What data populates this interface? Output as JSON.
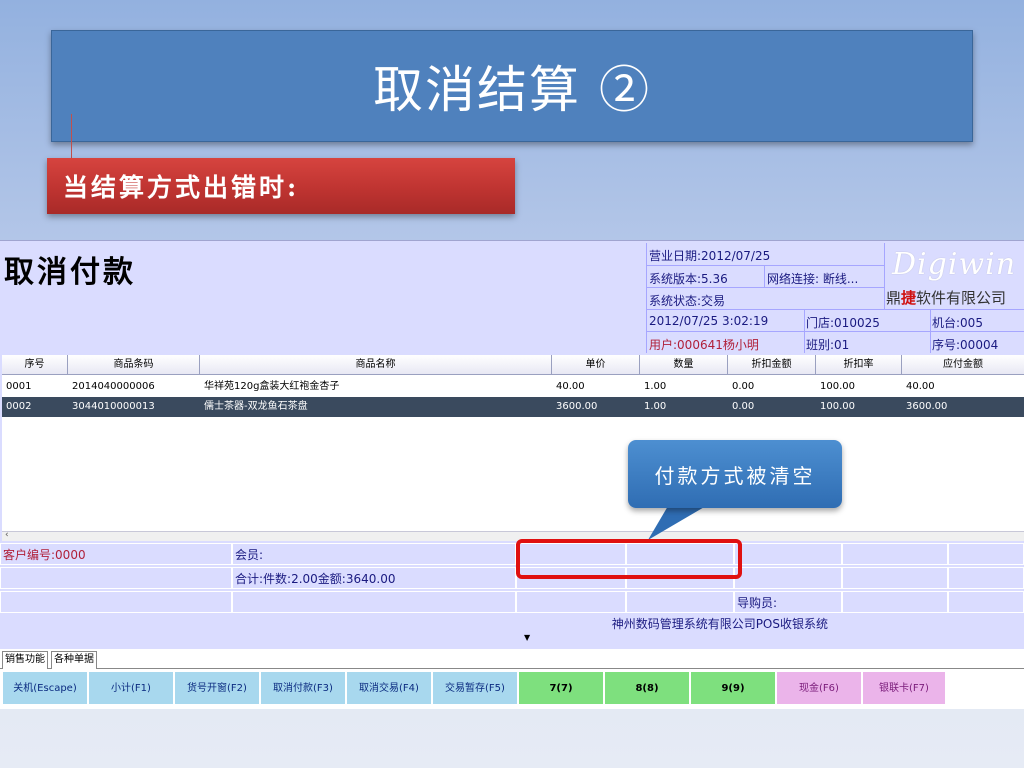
{
  "slide": {
    "title": "取消结算 ②",
    "subtitle": "当结算方式出错时:",
    "callout": "付款方式被清空"
  },
  "pos": {
    "screen_title": "取消付款",
    "info": {
      "business_date": "营业日期:2012/07/25",
      "system_version": "系统版本:5.36",
      "network": "网络连接: 断线...",
      "system_status": "系统状态:交易",
      "datetime": "2012/07/25 3:02:19",
      "store": "门店:010025",
      "machine": "机台:005",
      "user": "用户:000641杨小明",
      "shift": "班别:01",
      "sequence": "序号:00004"
    },
    "logo": {
      "script": "Digiwin",
      "company_a": "鼎",
      "company_b": "捷",
      "company_c": "软件有限公司"
    },
    "table": {
      "headers": [
        "序号",
        "商品条码",
        "商品名称",
        "单价",
        "数量",
        "折扣金额",
        "折扣率",
        "应付金额"
      ],
      "rows": [
        [
          "0001",
          "2014040000006",
          "华祥苑120g盒装大红袍金杏子",
          "40.00",
          "1.00",
          "0.00",
          "100.00",
          "40.00"
        ],
        [
          "0002",
          "3044010000013",
          "儒士茶器-双龙鱼石茶盘",
          "3600.00",
          "1.00",
          "0.00",
          "100.00",
          "3600.00"
        ]
      ]
    },
    "summary": {
      "customer_no": "客户编号:0000",
      "member": "会员:",
      "totals": "合计:件数:2.00金额:3640.00",
      "guide": "导购员:"
    },
    "status_company": "神州数码管理系统有限公司POS收银系统",
    "tabs": [
      "销售功能",
      "各种单据"
    ],
    "buttons": [
      {
        "label": "关机(Escape)"
      },
      {
        "label": "小计(F1)"
      },
      {
        "label": "货号开窗(F2)"
      },
      {
        "label": "取消付款(F3)"
      },
      {
        "label": "取消交易(F4)"
      },
      {
        "label": "交易暂存(F5)"
      },
      {
        "label": "7(7)"
      },
      {
        "label": "8(8)"
      },
      {
        "label": "9(9)"
      },
      {
        "label": "现金(F6)"
      },
      {
        "label": "银联卡(F7)"
      }
    ]
  },
  "colors": {
    "title_blue": "#4f81bd",
    "subtitle_red": "#c0504d",
    "pos_bg": "#dadcff",
    "highlight_red": "#e01010"
  }
}
